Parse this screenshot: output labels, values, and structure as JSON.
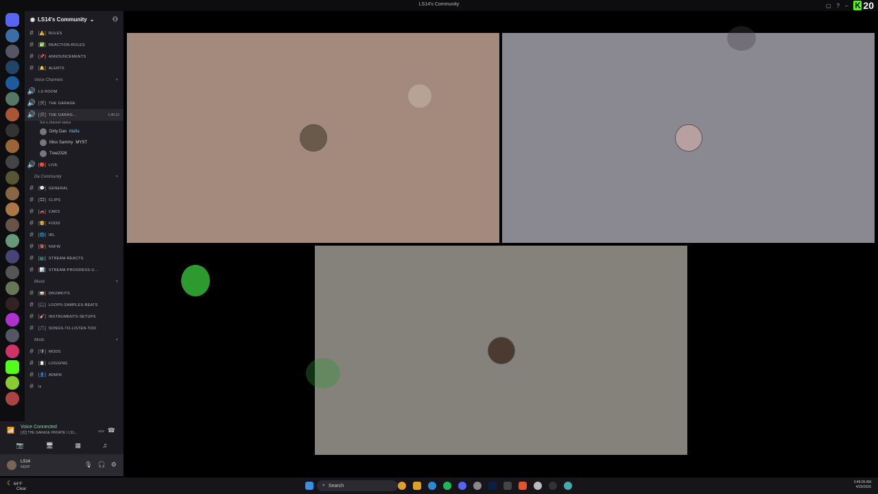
{
  "window": {
    "title": "LS14's Community",
    "kick_count": "20"
  },
  "server": {
    "name": "LS14's Community"
  },
  "channels": [
    {
      "type": "text",
      "emoji": "[⚠️]",
      "name": "RULES"
    },
    {
      "type": "text",
      "emoji": "[✅]",
      "name": "REACTION-ROLES"
    },
    {
      "type": "text",
      "emoji": "[📌]",
      "name": "ANNOUNCEMENTS"
    },
    {
      "type": "text",
      "emoji": "[🔔]",
      "name": "ALERTS"
    }
  ],
  "categories": {
    "voice": "Voice Channels",
    "community": "Da Community",
    "music": "Music",
    "mods": "Mods"
  },
  "voice_channels": {
    "ls_room": "LS ROOM",
    "garage1": "THE GARAGE",
    "garage2": "THE GARAG...",
    "timer": "1:45:16",
    "status": "Set a channel status",
    "live": "LIVE"
  },
  "members": [
    {
      "name": "Dirty Dan",
      "tag": "Mafia"
    },
    {
      "name": "Miss Sammy",
      "tag": "MYST"
    },
    {
      "name": "Tree2326",
      "tag": ""
    }
  ],
  "community_channels": [
    {
      "emoji": "[💬]",
      "name": "GENERAL"
    },
    {
      "emoji": "[🎞]",
      "name": "CLIPS"
    },
    {
      "emoji": "[🚗]",
      "name": "CARS"
    },
    {
      "emoji": "[🍔]",
      "name": "FOOD"
    },
    {
      "emoji": "[🌐]",
      "name": "IRL"
    },
    {
      "emoji": "[🔞]",
      "name": "NSFW"
    },
    {
      "emoji": "[📺]",
      "name": "STREAM-REACTS"
    },
    {
      "emoji": "[📊]",
      "name": "STREAM-PROGRESS-U..."
    }
  ],
  "music_channels": [
    {
      "emoji": "[🥁]",
      "name": "DRUMKITS"
    },
    {
      "emoji": "[🎧]",
      "name": "LOOPS-SAMPLES-BEATS"
    },
    {
      "emoji": "[🎸]",
      "name": "INSTRUMENTS-SETUPS"
    },
    {
      "emoji": "[🎵]",
      "name": "SONGS-TO-LISTEN-TOO"
    }
  ],
  "mod_channels": [
    {
      "emoji": "[🛡]",
      "name": "MODS"
    },
    {
      "emoji": "[📋]",
      "name": "LOGGING"
    },
    {
      "emoji": "[👤]",
      "name": "ADMIN"
    },
    {
      "emoji": "",
      "name": "ls"
    }
  ],
  "voice_panel": {
    "connected": "Voice Connected",
    "sub": "[🛠] THE GARAGE PRIVATE / LS1..."
  },
  "user_panel": {
    "name": "LS14",
    "status": "NERP"
  },
  "taskbar": {
    "weather_temp": "64°F",
    "weather_desc": "Clear",
    "search": "Search",
    "time": "3:49:05 AM",
    "date": "4/25/2026"
  }
}
